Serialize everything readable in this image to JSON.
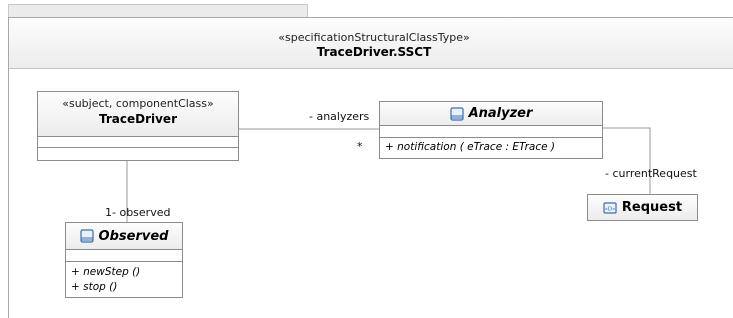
{
  "frame": {
    "stereotype": "«specificationStructuralClassType»",
    "name": "TraceDriver.SSCT"
  },
  "classes": {
    "trace_driver": {
      "stereotype": "«subject, componentClass»",
      "name": "TraceDriver"
    },
    "analyzer": {
      "name": "Analyzer",
      "icon": "class-icon",
      "operations": [
        "+ notification ( eTrace : ETrace )"
      ]
    },
    "observed": {
      "name": "Observed",
      "icon": "class-icon",
      "operations": [
        "+ newStep ()",
        "+ stop ()"
      ]
    },
    "request": {
      "name": "Request",
      "icon": "datatype-icon"
    }
  },
  "associations": {
    "analyzers_role": "- analyzers",
    "analyzers_multiplicity": "*",
    "current_request_role": "- currentRequest",
    "observed_role": "1- observed"
  },
  "colors": {
    "border": "#8c8c8c",
    "edge": "#9a9a9a",
    "icon_blue": "#3a6fb5"
  }
}
